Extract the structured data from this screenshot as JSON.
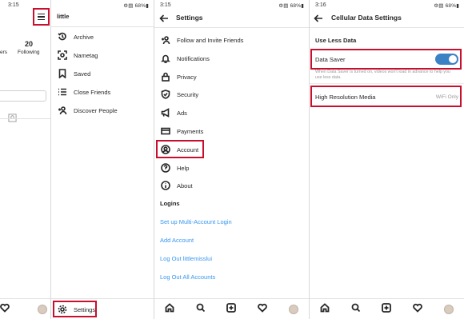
{
  "panel1": {
    "status_time": "3:15",
    "status_icons": "⚙︎▤ 68%▮",
    "followers_frag": "ers",
    "following_count": "20",
    "following_label": "Following"
  },
  "drawer": {
    "username": "little",
    "items": [
      {
        "label": "Archive",
        "icon": "archive-icon"
      },
      {
        "label": "Nametag",
        "icon": "nametag-icon"
      },
      {
        "label": "Saved",
        "icon": "bookmark-icon"
      },
      {
        "label": "Close Friends",
        "icon": "close-friends-icon"
      },
      {
        "label": "Discover People",
        "icon": "add-person-icon"
      }
    ],
    "settings_label": "Settings"
  },
  "settings": {
    "status_time": "3:15",
    "status_icons": "⚙︎▤ 68%▮",
    "title": "Settings",
    "items": [
      {
        "label": "Follow and Invite Friends",
        "icon": "add-person-icon"
      },
      {
        "label": "Notifications",
        "icon": "bell-icon"
      },
      {
        "label": "Privacy",
        "icon": "lock-icon"
      },
      {
        "label": "Security",
        "icon": "shield-icon"
      },
      {
        "label": "Ads",
        "icon": "megaphone-icon"
      },
      {
        "label": "Payments",
        "icon": "card-icon"
      },
      {
        "label": "Account",
        "icon": "account-icon"
      },
      {
        "label": "Help",
        "icon": "help-icon"
      },
      {
        "label": "About",
        "icon": "info-icon"
      }
    ],
    "logins_header": "Logins",
    "links": [
      "Set up Multi-Account Login",
      "Add Account",
      "Log Out littlemisslui",
      "Log Out All Accounts"
    ]
  },
  "cellular": {
    "status_time": "3:16",
    "status_icons": "⚙︎▤ 68%▮",
    "title": "Cellular Data Settings",
    "section_header": "Use Less Data",
    "data_saver_label": "Data Saver",
    "data_saver_on": true,
    "data_saver_desc": "When Data Saver is turned on, videos won't load in advance to help you use less data.",
    "hires_label": "High Resolution Media",
    "hires_value": "WiFi Only"
  },
  "colors": {
    "accent": "#3897f0",
    "highlight": "#c8102e",
    "toggle": "#3b82c4"
  }
}
